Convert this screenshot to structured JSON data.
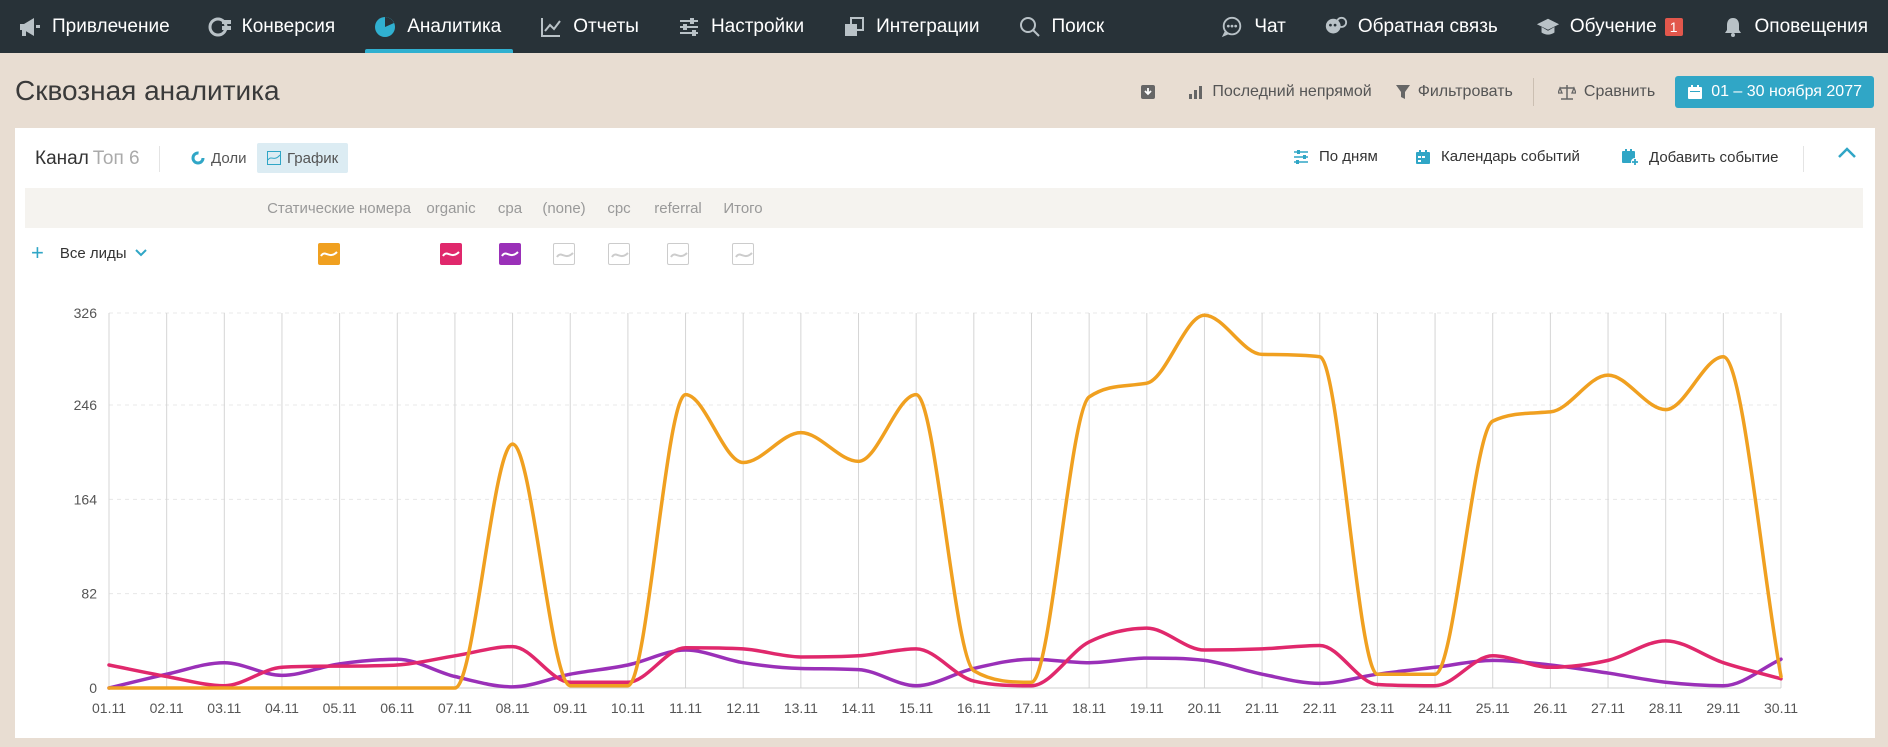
{
  "nav": {
    "items": [
      {
        "label": "Привлечение",
        "icon": "megaphone-icon"
      },
      {
        "label": "Конверсия",
        "icon": "funnel-icon"
      },
      {
        "label": "Аналитика",
        "icon": "pie-chart-icon",
        "active": true
      },
      {
        "label": "Отчеты",
        "icon": "line-chart-icon"
      },
      {
        "label": "Настройки",
        "icon": "sliders-icon"
      },
      {
        "label": "Интеграции",
        "icon": "puzzle-icon"
      },
      {
        "label": "Поиск",
        "icon": "search-icon"
      }
    ],
    "right": [
      {
        "label": "Чат",
        "icon": "chat-icon"
      },
      {
        "label": "Обратная связь",
        "icon": "feedback-icon"
      },
      {
        "label": "Обучение",
        "icon": "graduation-cap-icon",
        "badge": "1"
      },
      {
        "label": "Оповещения",
        "icon": "bell-icon"
      }
    ]
  },
  "page": {
    "title": "Сквозная аналитика",
    "attribution": "Последний непрямой",
    "filter": "Фильтровать",
    "compare": "Сравнить",
    "date_range": "01 – 30 ноября 2077"
  },
  "card": {
    "title": "Канал",
    "subtitle": "Топ 6",
    "tab_shares": "Доли",
    "tab_chart": "График",
    "by_days": "По дням",
    "events_calendar": "Календарь событий",
    "add_event": "Добавить событие",
    "leads_selector": "Все лиды",
    "plus": "+"
  },
  "colors": {
    "static_numbers": "#f0a020",
    "organic": "#e0286c",
    "cpa": "#9a30b8",
    "accent": "#30a6c6",
    "nav_bg": "#283238"
  },
  "chart_data": {
    "type": "line",
    "columns": [
      "Статические номера",
      "organic",
      "cpa",
      "(none)",
      "cpc",
      "referral",
      "Итого"
    ],
    "legend_active": [
      true,
      true,
      true,
      false,
      false,
      false,
      false
    ],
    "x": [
      "01.11",
      "02.11",
      "03.11",
      "04.11",
      "05.11",
      "06.11",
      "07.11",
      "08.11",
      "09.11",
      "10.11",
      "11.11",
      "12.11",
      "13.11",
      "14.11",
      "15.11",
      "16.11",
      "17.11",
      "18.11",
      "19.11",
      "20.11",
      "21.11",
      "22.11",
      "23.11",
      "24.11",
      "25.11",
      "26.11",
      "27.11",
      "28.11",
      "29.11",
      "30.11"
    ],
    "y_ticks": [
      0,
      82,
      164,
      246,
      326
    ],
    "ylim": [
      0,
      326
    ],
    "grid": true,
    "series": [
      {
        "name": "Статические номера",
        "color": "#f0a020",
        "values": [
          0,
          0,
          0,
          0,
          0,
          0,
          0,
          212,
          2,
          2,
          255,
          196,
          222,
          197,
          255,
          15,
          5,
          253,
          265,
          324,
          290,
          288,
          12,
          12,
          232,
          240,
          272,
          242,
          288,
          10
        ]
      },
      {
        "name": "organic",
        "color": "#e0286c",
        "values": [
          20,
          10,
          2,
          18,
          19,
          20,
          28,
          36,
          5,
          5,
          35,
          34,
          27,
          28,
          34,
          6,
          2,
          40,
          52,
          33,
          34,
          37,
          3,
          2,
          28,
          18,
          24,
          41,
          22,
          8
        ]
      },
      {
        "name": "cpa",
        "color": "#9a30b8",
        "values": [
          0,
          12,
          22,
          11,
          21,
          25,
          10,
          1,
          12,
          20,
          33,
          22,
          17,
          16,
          2,
          17,
          25,
          22,
          26,
          24,
          12,
          4,
          12,
          18,
          24,
          20,
          13,
          5,
          2,
          25
        ]
      }
    ]
  }
}
